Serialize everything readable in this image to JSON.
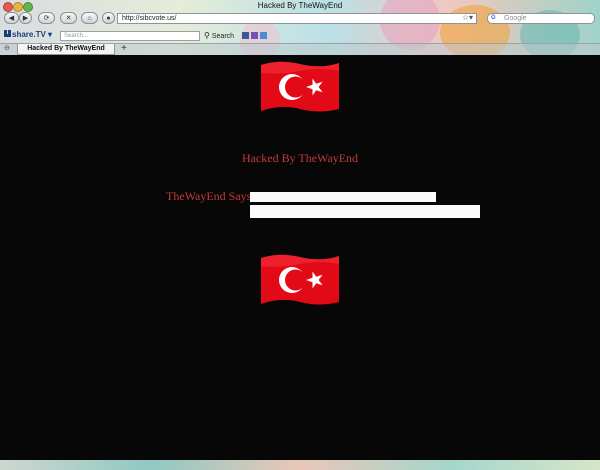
{
  "window": {
    "title": "Hacked By TheWayEnd"
  },
  "navbar": {
    "back_label": "◀",
    "forward_label": "▶",
    "reload_label": "⟳",
    "stop_label": "✕",
    "home_label": "⌂",
    "url": "http://sibcvote.us/",
    "search_placeholder": "Google"
  },
  "toolbar": {
    "logo_text": "share.TV",
    "search_placeholder": "Search...",
    "search_button": "Search"
  },
  "tabs": [
    {
      "label": "Hacked By TheWayEnd"
    }
  ],
  "page": {
    "headline": "Hacked By TheWayEnd",
    "says_label": "TheWayEnd Says:"
  },
  "colors": {
    "page_bg": "#070707",
    "text_red": "#c23a3a",
    "flag_red": "#e30a17"
  }
}
